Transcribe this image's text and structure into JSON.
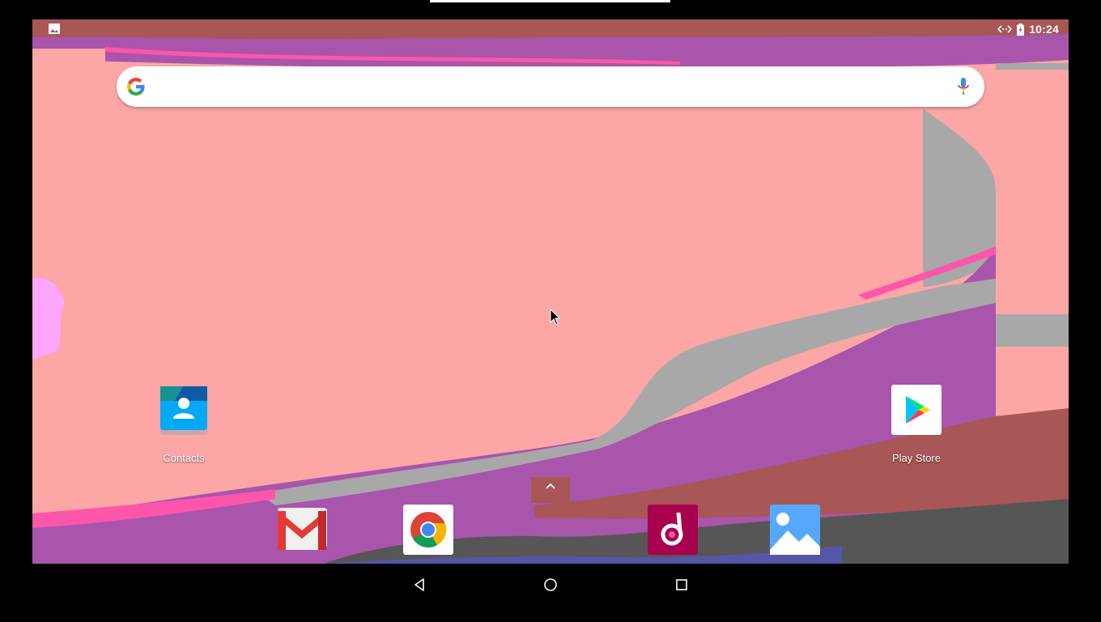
{
  "status_bar": {
    "time": "10:24",
    "icons": [
      "image-notification-icon",
      "data-transfer-icon",
      "battery-charging-icon"
    ]
  },
  "search": {
    "placeholder": "",
    "logo": "google-g-icon",
    "mic": "mic-icon"
  },
  "desktop_apps": [
    {
      "label": "Contacts",
      "icon": "contacts-icon"
    },
    {
      "label": "Play Store",
      "icon": "play-store-icon"
    }
  ],
  "dock": [
    {
      "icon": "gmail-icon"
    },
    {
      "icon": "chrome-icon"
    },
    {
      "icon": "music-icon"
    },
    {
      "icon": "gallery-icon"
    }
  ],
  "nav": [
    "back-icon",
    "home-icon",
    "recents-icon"
  ],
  "colors": {
    "wall_pink": "#fca6a6",
    "wall_purple": "#a855ab",
    "wall_red": "#a85656",
    "wall_gray": "#a8a8a8",
    "wall_hotpink": "#fc56ab",
    "wall_dark": "#565656"
  }
}
